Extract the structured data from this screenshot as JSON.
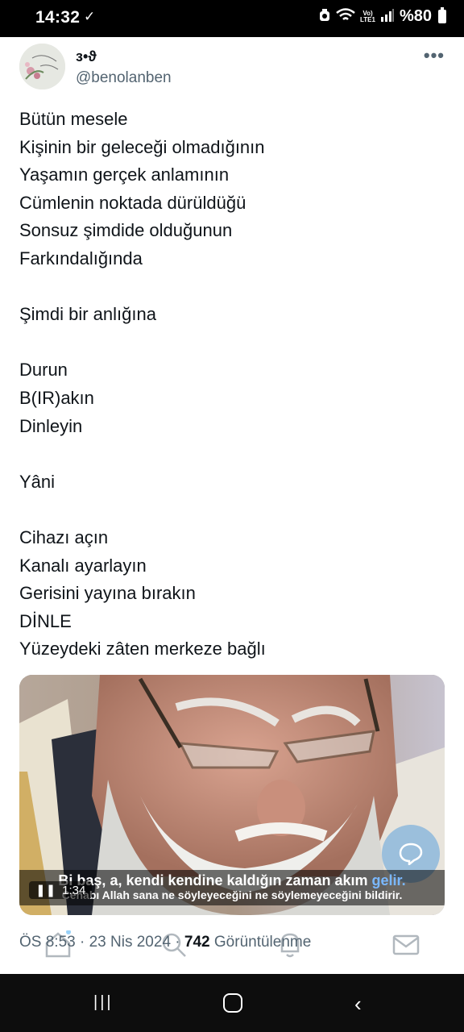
{
  "status_bar": {
    "time": "14:32",
    "check_icon": "check-icon",
    "battery_text": "%80",
    "lte_top": "Vo)",
    "lte_bottom": "LTE1"
  },
  "tweet": {
    "display_name": "з•ϑ",
    "handle": "@benolanben",
    "lines": [
      "Bütün mesele",
      "Kişinin bir geleceği olmadığının",
      "Yaşamın gerçek anlamının",
      "Cümlenin noktada dürüldüğü",
      "Sonsuz şimdide olduğunun",
      "Farkındalığında",
      "",
      "Şimdi bir anlığına",
      "",
      "Durun",
      "B(IR)akın",
      "Dinleyin",
      "",
      "Yâni",
      "",
      "Cihazı açın",
      "Kanalı ayarlayın",
      "Gerisini yayına bırakın",
      "DİNLE",
      "Yüzeydeki zâten merkeze bağlı"
    ],
    "video": {
      "subtitle_line1_a": "Bi baş, ",
      "subtitle_line1_b": "a, kendi kendine kaldığın zaman akım ",
      "subtitle_line1_c": "gelir.",
      "subtitle_line2": "Cenabı Allah sana ne söyleyeceğini ne söylemeyeceğini bildirir.",
      "duration": "1:34"
    },
    "meta": {
      "time": "ÖS 8:53",
      "date": "23 Nis 2024",
      "views": "742",
      "views_label": "Görüntülenme"
    }
  },
  "colors": {
    "text": "#0f1419",
    "secondary": "#536471",
    "status_bar": "#000000",
    "nav_bar": "#0d0d0d"
  }
}
